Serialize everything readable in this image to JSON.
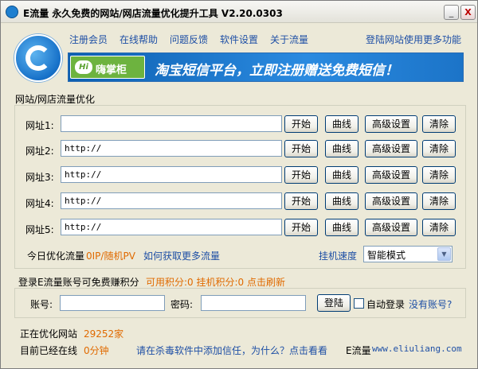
{
  "window": {
    "title": "E流量 永久免费的网站/网店流量优化提升工具 V2.20.0303",
    "minimize_glyph": "_",
    "close_glyph": "X"
  },
  "menu": {
    "items": [
      "注册会员",
      "在线帮助",
      "问题反馈",
      "软件设置",
      "关于流量"
    ],
    "right_link": "登陆网站使用更多功能"
  },
  "banner": {
    "badge_prefix": "Hi",
    "badge_text": "嗨掌柜",
    "text": "淘宝短信平台，立即注册赠送免费短信！"
  },
  "section_title": "网站/网店流量优化",
  "urls": {
    "rows": [
      {
        "label": "网址1:",
        "value": ""
      },
      {
        "label": "网址2:",
        "value": "http://"
      },
      {
        "label": "网址3:",
        "value": "http://"
      },
      {
        "label": "网址4:",
        "value": "http://"
      },
      {
        "label": "网址5:",
        "value": "http://"
      }
    ],
    "buttons": {
      "start": "开始",
      "curve": "曲线",
      "advanced": "高级设置",
      "clear": "清除"
    }
  },
  "today": {
    "label": "今日优化流量",
    "value": "0IP/随机PV",
    "link": "如何获取更多流量"
  },
  "speed": {
    "label": "挂机速度",
    "selected": "智能模式"
  },
  "login": {
    "title": "登录E流量账号可免费赚积分",
    "points": "可用积分:0 挂机积分:0 点击刷新",
    "account_label": "账号:",
    "password_label": "密码:",
    "login_button": "登陆",
    "auto_login_label": "自动登录",
    "no_account_link": "没有账号?"
  },
  "status": {
    "optimizing_label": "正在优化网站",
    "optimizing_count": "29252家",
    "online_label": "目前已经在线",
    "online_value": "0分钟",
    "trust_link": "请在杀毒软件中添加信任，为什么？点击看看",
    "brand": "E流量",
    "url": "www.eliuliang.com"
  },
  "colors": {
    "link": "#1E4FA5",
    "highlight": "#E06A00",
    "banner": "#1E7FD0",
    "window_bg": "#ECE9D8"
  }
}
